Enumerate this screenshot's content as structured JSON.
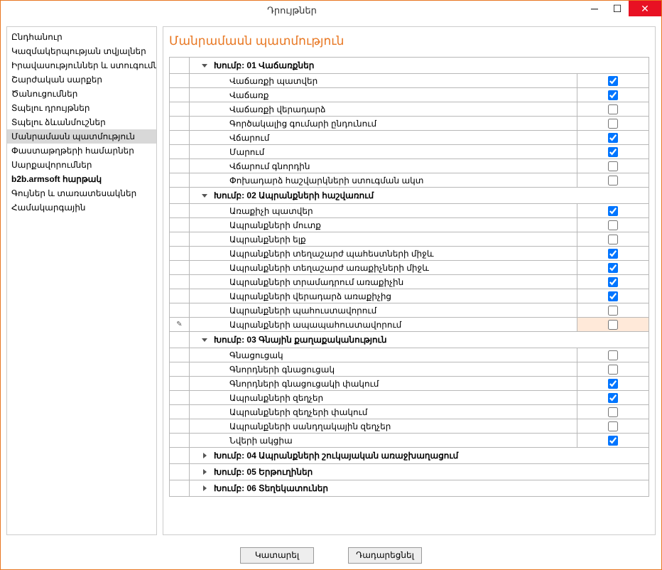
{
  "window": {
    "title": "Դրույթներ",
    "buttons": {
      "minimize": "–",
      "maximize": "◻",
      "close": "✕"
    }
  },
  "sidebar": {
    "items": [
      {
        "label": "Ընդհանուր",
        "selected": false,
        "bold": false
      },
      {
        "label": "Կազմակերպության տվյալներ",
        "selected": false,
        "bold": false
      },
      {
        "label": "Իրավասություններ և ստուգումներ",
        "selected": false,
        "bold": false
      },
      {
        "label": "Շարժական սարքեր",
        "selected": false,
        "bold": false
      },
      {
        "label": "Ծանուցումներ",
        "selected": false,
        "bold": false
      },
      {
        "label": "Տպելու դրույթներ",
        "selected": false,
        "bold": false
      },
      {
        "label": "Տպելու ձևանմուշներ",
        "selected": false,
        "bold": false
      },
      {
        "label": "Մանրամասն պատմություն",
        "selected": true,
        "bold": false
      },
      {
        "label": "Փաստաթղթերի համարներ",
        "selected": false,
        "bold": false
      },
      {
        "label": "Սարքավորումներ",
        "selected": false,
        "bold": false
      },
      {
        "label": "b2b.armsoft հարթակ",
        "selected": false,
        "bold": true
      },
      {
        "label": "Գույներ և տառատեսակներ",
        "selected": false,
        "bold": false
      },
      {
        "label": "Համակարգային",
        "selected": false,
        "bold": false
      }
    ]
  },
  "main": {
    "title": "Մանրամասն պատմություն"
  },
  "groups": [
    {
      "label": "Խումբ: 01 Վաճառքներ",
      "expanded": true,
      "rows": [
        {
          "label": "Վաճառքի պատվեր",
          "checked": true
        },
        {
          "label": "Վաճառք",
          "checked": true
        },
        {
          "label": "Վաճառքի վերադարձ",
          "checked": false
        },
        {
          "label": "Գործակալից գումարի ընդունում",
          "checked": false
        },
        {
          "label": "Վճարում",
          "checked": true
        },
        {
          "label": "Մարում",
          "checked": true
        },
        {
          "label": "Վճարում գնորդին",
          "checked": false
        },
        {
          "label": "Փոխադարձ հաշվարկների ստուգման ակտ",
          "checked": false
        }
      ]
    },
    {
      "label": "Խումբ: 02 Ապրանքների հաշվառում",
      "expanded": true,
      "rows": [
        {
          "label": "Առաքիչի պատվեր",
          "checked": true
        },
        {
          "label": "Ապրանքների մուտք",
          "checked": false
        },
        {
          "label": "Ապրանքների ելք",
          "checked": false
        },
        {
          "label": "Ապրանքների տեղաշարժ պահեստների միջև",
          "checked": true
        },
        {
          "label": "Ապրանքների տեղաշարժ առաքիչների միջև",
          "checked": true
        },
        {
          "label": "Ապրանքների տրամադրում առաքիչին",
          "checked": true
        },
        {
          "label": "Ապրանքների վերադարձ առաքիչից",
          "checked": true
        },
        {
          "label": "Ապրանքների պահուստավորում",
          "checked": false
        },
        {
          "label": "Ապրանքների ապապահուստավորում",
          "checked": false,
          "highlight": true,
          "editing": true
        }
      ]
    },
    {
      "label": "Խումբ: 03 Գնային քաղաքականություն",
      "expanded": true,
      "rows": [
        {
          "label": "Գնացուցակ",
          "checked": false
        },
        {
          "label": "Գնորդների գնացուցակ",
          "checked": false
        },
        {
          "label": "Գնորդների գնացուցակի փակում",
          "checked": true
        },
        {
          "label": "Ապրանքների զեղչեր",
          "checked": true
        },
        {
          "label": "Ապրանքների զեղչերի փակում",
          "checked": false
        },
        {
          "label": "Ապրանքների սանդղակային զեղչեր",
          "checked": false
        },
        {
          "label": "Նվերի ակցիա",
          "checked": true
        }
      ]
    },
    {
      "label": "Խումբ: 04 Ապրանքների շուկայական առաջխաղացում",
      "expanded": false,
      "rows": []
    },
    {
      "label": "Խումբ: 05 Երթուղիներ",
      "expanded": false,
      "rows": []
    },
    {
      "label": "Խումբ: 06 Տեղեկատուներ",
      "expanded": false,
      "rows": []
    }
  ],
  "footer": {
    "ok": "Կատարել",
    "cancel": "Դադարեցնել"
  }
}
